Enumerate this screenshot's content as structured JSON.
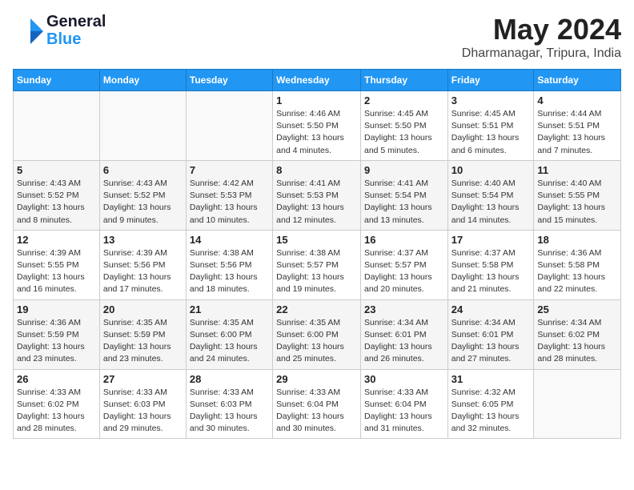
{
  "header": {
    "logo_line1": "General",
    "logo_line2": "Blue",
    "title": "May 2024",
    "subtitle": "Dharmanagar, Tripura, India"
  },
  "weekdays": [
    "Sunday",
    "Monday",
    "Tuesday",
    "Wednesday",
    "Thursday",
    "Friday",
    "Saturday"
  ],
  "weeks": [
    [
      {
        "num": "",
        "sunrise": "",
        "sunset": "",
        "daylight": ""
      },
      {
        "num": "",
        "sunrise": "",
        "sunset": "",
        "daylight": ""
      },
      {
        "num": "",
        "sunrise": "",
        "sunset": "",
        "daylight": ""
      },
      {
        "num": "1",
        "sunrise": "Sunrise: 4:46 AM",
        "sunset": "Sunset: 5:50 PM",
        "daylight": "Daylight: 13 hours and 4 minutes."
      },
      {
        "num": "2",
        "sunrise": "Sunrise: 4:45 AM",
        "sunset": "Sunset: 5:50 PM",
        "daylight": "Daylight: 13 hours and 5 minutes."
      },
      {
        "num": "3",
        "sunrise": "Sunrise: 4:45 AM",
        "sunset": "Sunset: 5:51 PM",
        "daylight": "Daylight: 13 hours and 6 minutes."
      },
      {
        "num": "4",
        "sunrise": "Sunrise: 4:44 AM",
        "sunset": "Sunset: 5:51 PM",
        "daylight": "Daylight: 13 hours and 7 minutes."
      }
    ],
    [
      {
        "num": "5",
        "sunrise": "Sunrise: 4:43 AM",
        "sunset": "Sunset: 5:52 PM",
        "daylight": "Daylight: 13 hours and 8 minutes."
      },
      {
        "num": "6",
        "sunrise": "Sunrise: 4:43 AM",
        "sunset": "Sunset: 5:52 PM",
        "daylight": "Daylight: 13 hours and 9 minutes."
      },
      {
        "num": "7",
        "sunrise": "Sunrise: 4:42 AM",
        "sunset": "Sunset: 5:53 PM",
        "daylight": "Daylight: 13 hours and 10 minutes."
      },
      {
        "num": "8",
        "sunrise": "Sunrise: 4:41 AM",
        "sunset": "Sunset: 5:53 PM",
        "daylight": "Daylight: 13 hours and 12 minutes."
      },
      {
        "num": "9",
        "sunrise": "Sunrise: 4:41 AM",
        "sunset": "Sunset: 5:54 PM",
        "daylight": "Daylight: 13 hours and 13 minutes."
      },
      {
        "num": "10",
        "sunrise": "Sunrise: 4:40 AM",
        "sunset": "Sunset: 5:54 PM",
        "daylight": "Daylight: 13 hours and 14 minutes."
      },
      {
        "num": "11",
        "sunrise": "Sunrise: 4:40 AM",
        "sunset": "Sunset: 5:55 PM",
        "daylight": "Daylight: 13 hours and 15 minutes."
      }
    ],
    [
      {
        "num": "12",
        "sunrise": "Sunrise: 4:39 AM",
        "sunset": "Sunset: 5:55 PM",
        "daylight": "Daylight: 13 hours and 16 minutes."
      },
      {
        "num": "13",
        "sunrise": "Sunrise: 4:39 AM",
        "sunset": "Sunset: 5:56 PM",
        "daylight": "Daylight: 13 hours and 17 minutes."
      },
      {
        "num": "14",
        "sunrise": "Sunrise: 4:38 AM",
        "sunset": "Sunset: 5:56 PM",
        "daylight": "Daylight: 13 hours and 18 minutes."
      },
      {
        "num": "15",
        "sunrise": "Sunrise: 4:38 AM",
        "sunset": "Sunset: 5:57 PM",
        "daylight": "Daylight: 13 hours and 19 minutes."
      },
      {
        "num": "16",
        "sunrise": "Sunrise: 4:37 AM",
        "sunset": "Sunset: 5:57 PM",
        "daylight": "Daylight: 13 hours and 20 minutes."
      },
      {
        "num": "17",
        "sunrise": "Sunrise: 4:37 AM",
        "sunset": "Sunset: 5:58 PM",
        "daylight": "Daylight: 13 hours and 21 minutes."
      },
      {
        "num": "18",
        "sunrise": "Sunrise: 4:36 AM",
        "sunset": "Sunset: 5:58 PM",
        "daylight": "Daylight: 13 hours and 22 minutes."
      }
    ],
    [
      {
        "num": "19",
        "sunrise": "Sunrise: 4:36 AM",
        "sunset": "Sunset: 5:59 PM",
        "daylight": "Daylight: 13 hours and 23 minutes."
      },
      {
        "num": "20",
        "sunrise": "Sunrise: 4:35 AM",
        "sunset": "Sunset: 5:59 PM",
        "daylight": "Daylight: 13 hours and 23 minutes."
      },
      {
        "num": "21",
        "sunrise": "Sunrise: 4:35 AM",
        "sunset": "Sunset: 6:00 PM",
        "daylight": "Daylight: 13 hours and 24 minutes."
      },
      {
        "num": "22",
        "sunrise": "Sunrise: 4:35 AM",
        "sunset": "Sunset: 6:00 PM",
        "daylight": "Daylight: 13 hours and 25 minutes."
      },
      {
        "num": "23",
        "sunrise": "Sunrise: 4:34 AM",
        "sunset": "Sunset: 6:01 PM",
        "daylight": "Daylight: 13 hours and 26 minutes."
      },
      {
        "num": "24",
        "sunrise": "Sunrise: 4:34 AM",
        "sunset": "Sunset: 6:01 PM",
        "daylight": "Daylight: 13 hours and 27 minutes."
      },
      {
        "num": "25",
        "sunrise": "Sunrise: 4:34 AM",
        "sunset": "Sunset: 6:02 PM",
        "daylight": "Daylight: 13 hours and 28 minutes."
      }
    ],
    [
      {
        "num": "26",
        "sunrise": "Sunrise: 4:33 AM",
        "sunset": "Sunset: 6:02 PM",
        "daylight": "Daylight: 13 hours and 28 minutes."
      },
      {
        "num": "27",
        "sunrise": "Sunrise: 4:33 AM",
        "sunset": "Sunset: 6:03 PM",
        "daylight": "Daylight: 13 hours and 29 minutes."
      },
      {
        "num": "28",
        "sunrise": "Sunrise: 4:33 AM",
        "sunset": "Sunset: 6:03 PM",
        "daylight": "Daylight: 13 hours and 30 minutes."
      },
      {
        "num": "29",
        "sunrise": "Sunrise: 4:33 AM",
        "sunset": "Sunset: 6:04 PM",
        "daylight": "Daylight: 13 hours and 30 minutes."
      },
      {
        "num": "30",
        "sunrise": "Sunrise: 4:33 AM",
        "sunset": "Sunset: 6:04 PM",
        "daylight": "Daylight: 13 hours and 31 minutes."
      },
      {
        "num": "31",
        "sunrise": "Sunrise: 4:32 AM",
        "sunset": "Sunset: 6:05 PM",
        "daylight": "Daylight: 13 hours and 32 minutes."
      },
      {
        "num": "",
        "sunrise": "",
        "sunset": "",
        "daylight": ""
      }
    ]
  ]
}
